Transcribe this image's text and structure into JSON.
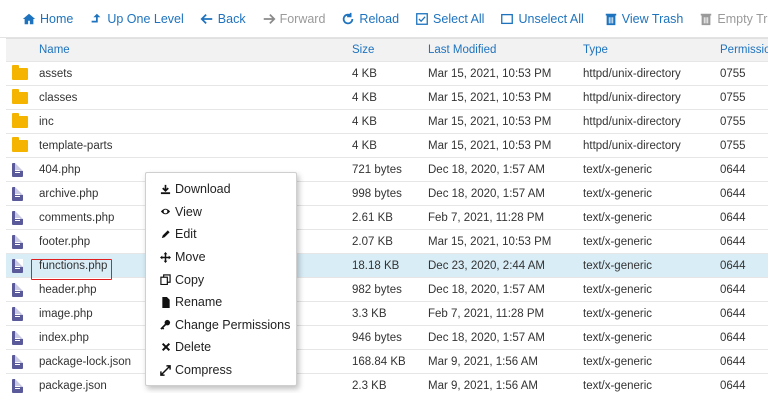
{
  "toolbar": {
    "home": "Home",
    "up": "Up One Level",
    "back": "Back",
    "forward": "Forward",
    "reload": "Reload",
    "select_all": "Select All",
    "unselect_all": "Unselect All",
    "view_trash": "View Trash",
    "empty_trash": "Empty Trash"
  },
  "columns": {
    "name": "Name",
    "size": "Size",
    "modified": "Last Modified",
    "type": "Type",
    "perms": "Permissio"
  },
  "rows": [
    {
      "name": "assets",
      "size": "4 KB",
      "modified": "Mar 15, 2021, 10:53 PM",
      "type": "httpd/unix-directory",
      "perms": "0755",
      "kind": "folder"
    },
    {
      "name": "classes",
      "size": "4 KB",
      "modified": "Mar 15, 2021, 10:53 PM",
      "type": "httpd/unix-directory",
      "perms": "0755",
      "kind": "folder"
    },
    {
      "name": "inc",
      "size": "4 KB",
      "modified": "Mar 15, 2021, 10:53 PM",
      "type": "httpd/unix-directory",
      "perms": "0755",
      "kind": "folder"
    },
    {
      "name": "template-parts",
      "size": "4 KB",
      "modified": "Mar 15, 2021, 10:53 PM",
      "type": "httpd/unix-directory",
      "perms": "0755",
      "kind": "folder"
    },
    {
      "name": "404.php",
      "size": "721 bytes",
      "modified": "Dec 18, 2020, 1:57 AM",
      "type": "text/x-generic",
      "perms": "0644",
      "kind": "file"
    },
    {
      "name": "archive.php",
      "size": "998 bytes",
      "modified": "Dec 18, 2020, 1:57 AM",
      "type": "text/x-generic",
      "perms": "0644",
      "kind": "file"
    },
    {
      "name": "comments.php",
      "size": "2.61 KB",
      "modified": "Feb 7, 2021, 11:28 PM",
      "type": "text/x-generic",
      "perms": "0644",
      "kind": "file"
    },
    {
      "name": "footer.php",
      "size": "2.07 KB",
      "modified": "Mar 15, 2021, 10:53 PM",
      "type": "text/x-generic",
      "perms": "0644",
      "kind": "file"
    },
    {
      "name": "functions.php",
      "size": "18.18 KB",
      "modified": "Dec 23, 2020, 2:44 AM",
      "type": "text/x-generic",
      "perms": "0644",
      "kind": "file",
      "selected": true
    },
    {
      "name": "header.php",
      "size": "982 bytes",
      "modified": "Dec 18, 2020, 1:57 AM",
      "type": "text/x-generic",
      "perms": "0644",
      "kind": "file"
    },
    {
      "name": "image.php",
      "size": "3.3 KB",
      "modified": "Feb 7, 2021, 11:28 PM",
      "type": "text/x-generic",
      "perms": "0644",
      "kind": "file"
    },
    {
      "name": "index.php",
      "size": "946 bytes",
      "modified": "Dec 18, 2020, 1:57 AM",
      "type": "text/x-generic",
      "perms": "0644",
      "kind": "file"
    },
    {
      "name": "package-lock.json",
      "size": "168.84 KB",
      "modified": "Mar 9, 2021, 1:56 AM",
      "type": "text/x-generic",
      "perms": "0644",
      "kind": "file"
    },
    {
      "name": "package.json",
      "size": "2.3 KB",
      "modified": "Mar 9, 2021, 1:56 AM",
      "type": "text/x-generic",
      "perms": "0644",
      "kind": "file"
    }
  ],
  "context_menu": [
    {
      "id": "download",
      "label": "Download",
      "icon": "download-icon"
    },
    {
      "id": "view",
      "label": "View",
      "icon": "eye-icon"
    },
    {
      "id": "edit",
      "label": "Edit",
      "icon": "pencil-icon"
    },
    {
      "id": "move",
      "label": "Move",
      "icon": "move-icon"
    },
    {
      "id": "copy",
      "label": "Copy",
      "icon": "copy-icon"
    },
    {
      "id": "rename",
      "label": "Rename",
      "icon": "file-icon"
    },
    {
      "id": "change-permissions",
      "label": "Change Permissions",
      "icon": "key-icon"
    },
    {
      "id": "delete",
      "label": "Delete",
      "icon": "x-icon"
    },
    {
      "id": "compress",
      "label": "Compress",
      "icon": "compress-icon"
    }
  ],
  "colors": {
    "link": "#1e73be",
    "folder": "#f4b400",
    "file": "#5a5a9a",
    "selected_row": "#d9edf7",
    "annotation": "#e02020"
  }
}
